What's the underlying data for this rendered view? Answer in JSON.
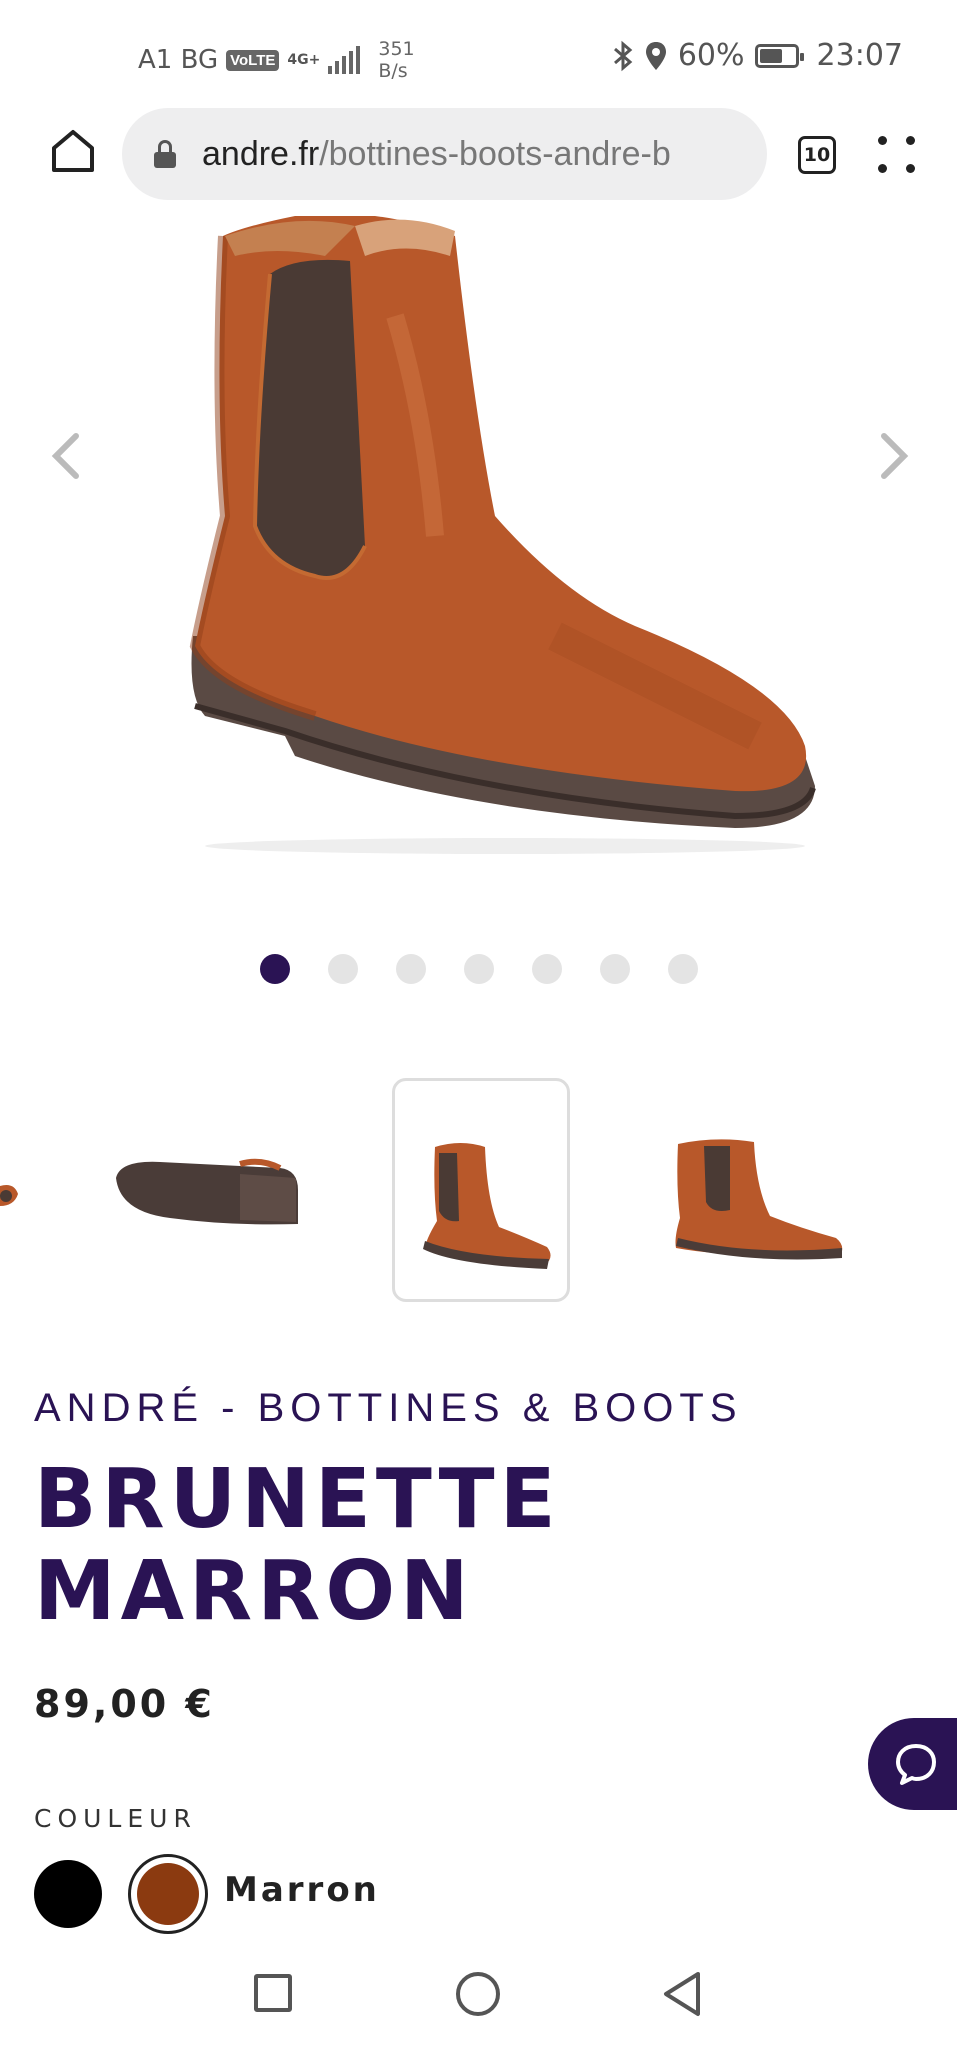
{
  "status_bar": {
    "carrier": "A1 BG",
    "volte": "VoLTE",
    "network": "4G+",
    "speed_value": "351",
    "speed_unit": "B/s",
    "battery_percent": "60%",
    "battery_level": 0.6,
    "time": "23:07",
    "icons": [
      "bluetooth-icon",
      "location-icon",
      "battery-icon"
    ]
  },
  "browser": {
    "url_host": "andre.fr",
    "url_path": "/bottines-boots-andre-b",
    "tab_count": "10",
    "icons": [
      "home-icon",
      "lock-icon",
      "tabs-icon",
      "menu-icon"
    ]
  },
  "gallery": {
    "slide_count": 7,
    "active_slide": 1,
    "icons": [
      "chevron-left-icon",
      "chevron-right-icon"
    ]
  },
  "product": {
    "brand_line": "ANDRÉ - BOTTINES & BOOTS",
    "title_line1": "BRUNETTE",
    "title_line2": "MARRON",
    "price": "89,00 €",
    "color_label": "COULEUR",
    "selected_color": "Marron",
    "swatches": [
      {
        "name": "noir",
        "hex": "#000000"
      },
      {
        "name": "Marron",
        "hex": "#8b3a10"
      }
    ]
  },
  "colors": {
    "brand_purple": "#2a1354",
    "boot_tan": "#b8582a",
    "dot_inactive": "#e4e4e4"
  }
}
